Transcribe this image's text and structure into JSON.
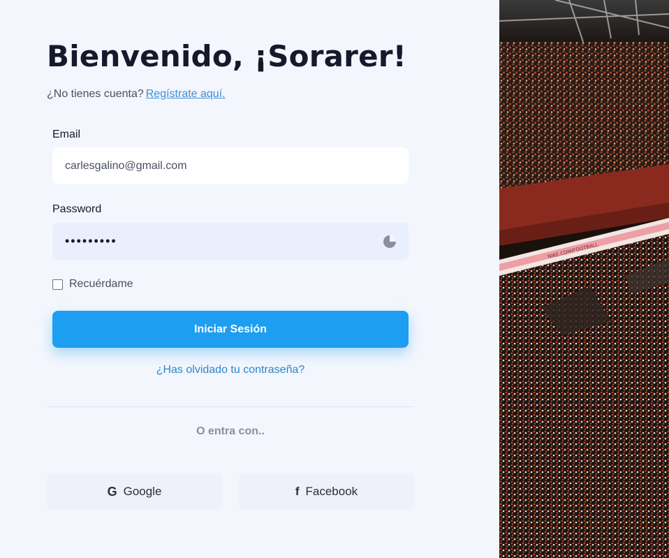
{
  "header": {
    "title": "Bienvenido, ¡Sorarer!",
    "signup_prompt": "¿No tienes cuenta?",
    "signup_link": "Regístrate aquí."
  },
  "form": {
    "email_label": "Email",
    "email_value": "carlesgalino@gmail.com",
    "password_label": "Password",
    "password_mask": "•••••••••",
    "remember_label": "Recuérdame",
    "submit_label": "Iniciar Sesión",
    "forgot_label": "¿Has olvidado tu contraseña?"
  },
  "social": {
    "divider_text": "O entra con..",
    "google_label": "Google",
    "facebook_label": "Facebook",
    "google_icon": "G",
    "facebook_icon": "f"
  },
  "hero_image": {
    "banner_text": "NIKE.COM/FOOTBALL"
  },
  "colors": {
    "accent": "#1d9ef0",
    "link": "#2a86c9",
    "background": "#f3f6fd"
  }
}
